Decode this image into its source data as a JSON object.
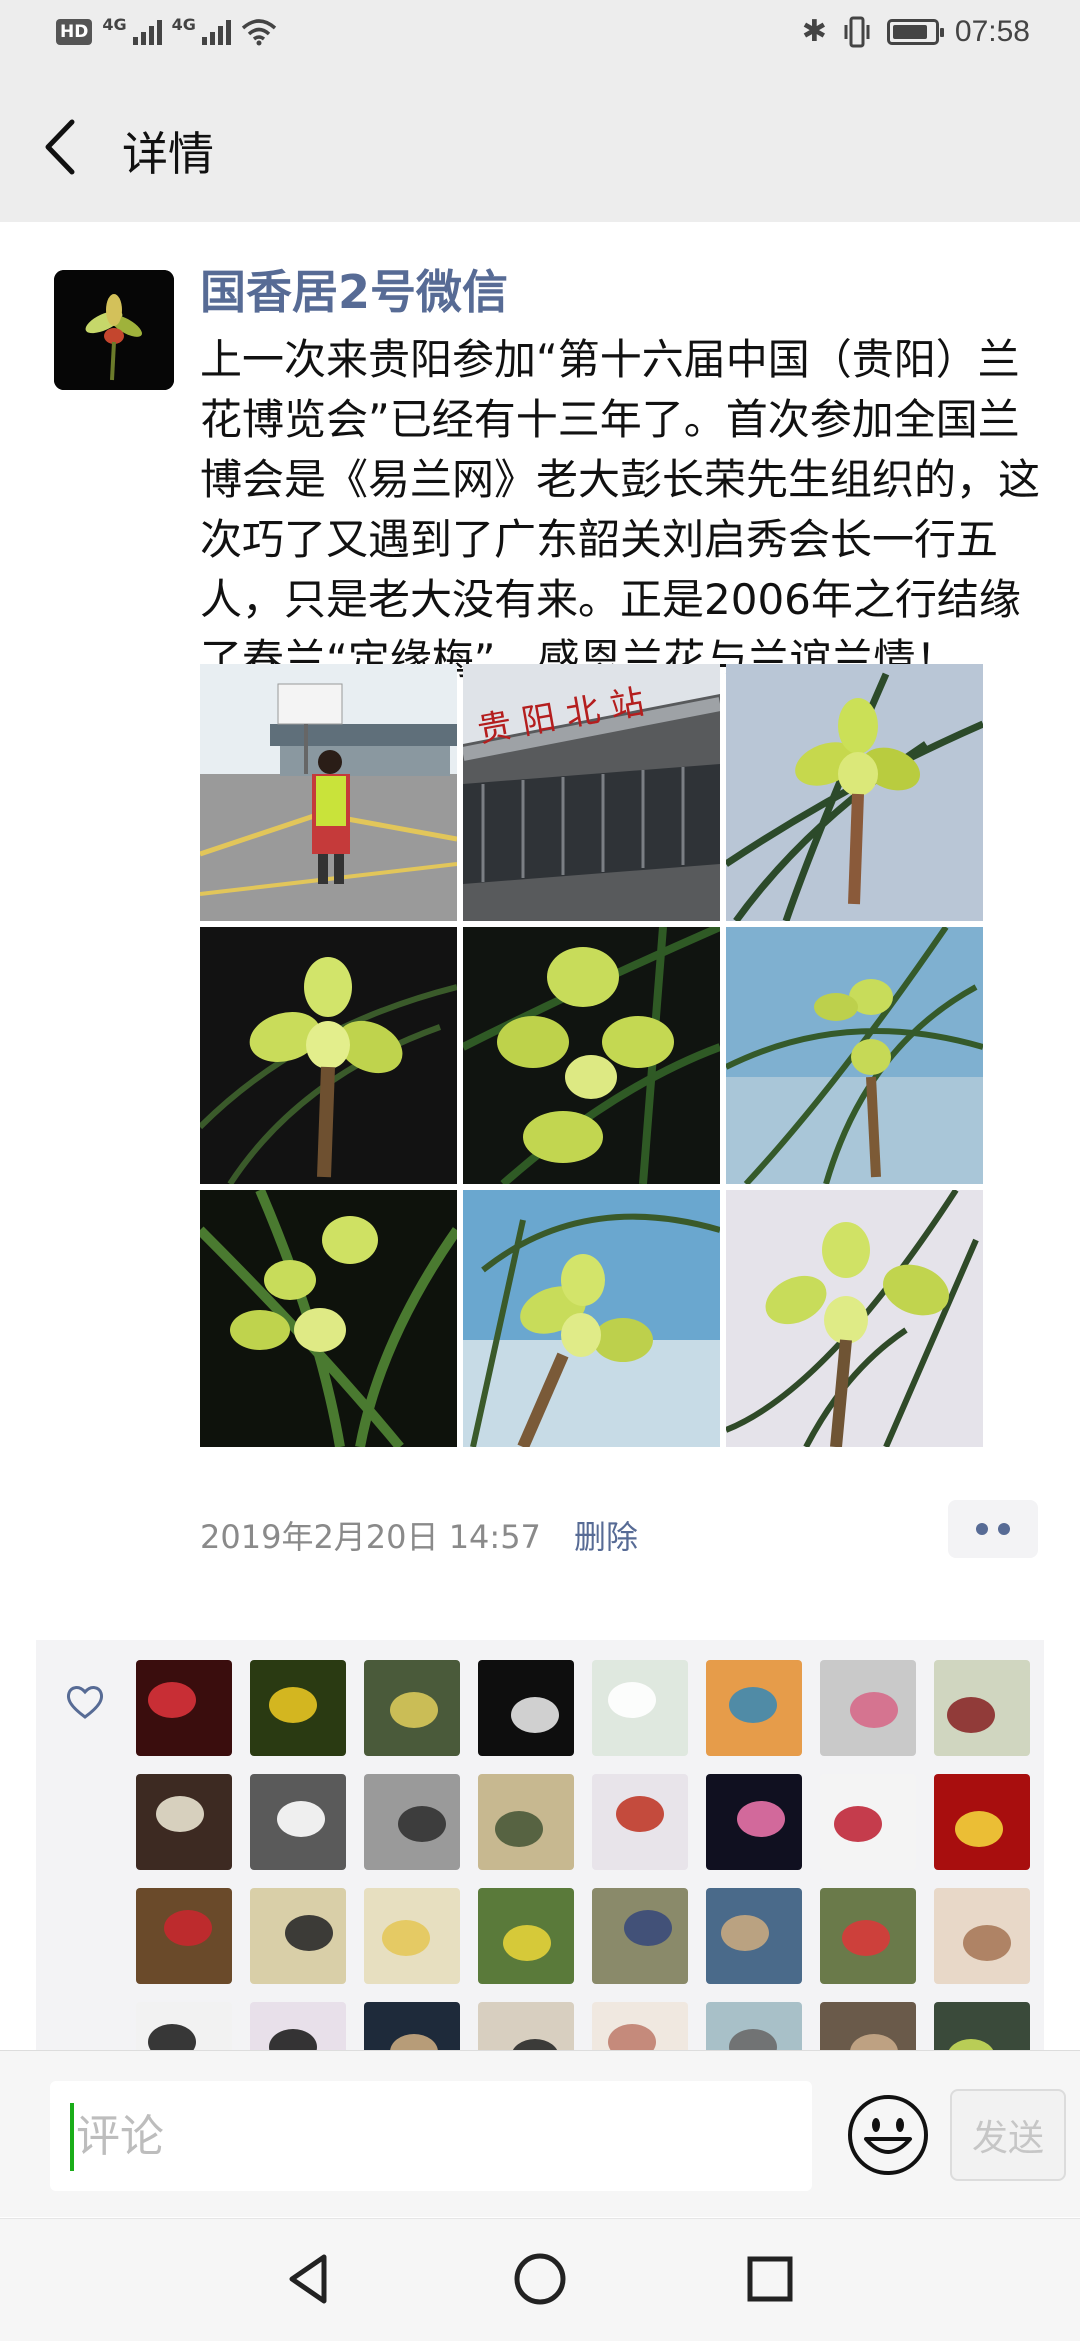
{
  "status_bar": {
    "hd_label": "HD",
    "network_1": "4G",
    "network_2": "4G",
    "time": "07:58",
    "battery_level": 0.85
  },
  "navbar": {
    "title": "详情"
  },
  "post": {
    "author": "国香居2号微信",
    "content": "上一次来贵阳参加“第十六届中国（贵阳）兰花博览会”已经有十三年了。首次参加全国兰博会是《易兰网》老大彭长荣先生组织的，这次巧了又遇到了广东韶关刘启秀会长一行五人，只是老大没有来。正是2006年之行结缘了春兰“定缘梅”，感恩兰花与兰谊兰情！",
    "photo_count": 9,
    "station_sign_text": "贵 阳 北 站",
    "timestamp": "2019年2月20日 14:57",
    "delete_label": "删除"
  },
  "likes": {
    "icon": "heart-icon",
    "avatar_count": 32
  },
  "comment": {
    "placeholder": "评论",
    "send_label": "发送"
  },
  "colors": {
    "link_blue": "#576b95",
    "bar_gray": "#ededed",
    "panel_gray": "#f3f3f5",
    "caret_green": "#1aad19"
  }
}
